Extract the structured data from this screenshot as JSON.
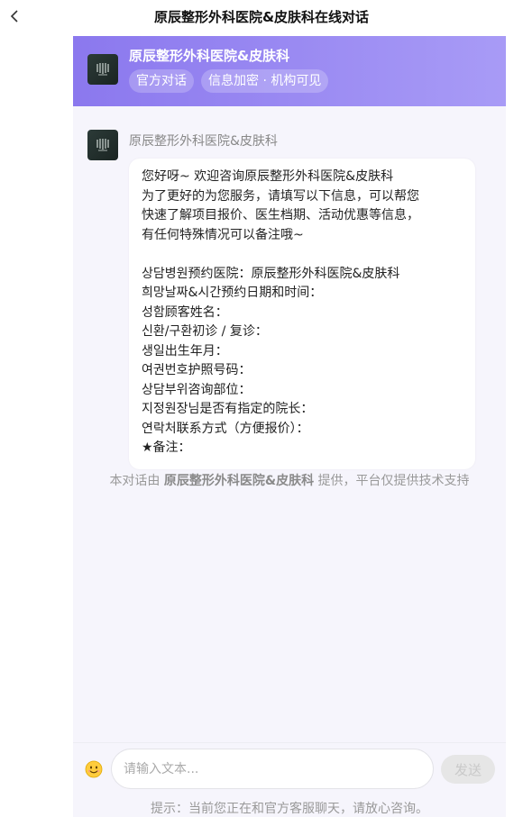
{
  "page": {
    "title": "原辰整形外科医院&皮肤科在线对话",
    "back_icon": "chevron-left-icon"
  },
  "header": {
    "name": "原辰整形外科医院&皮肤科",
    "logo_icon": "clinic-logo-icon",
    "tags": [
      "官方对话",
      "信息加密 · 机构可见"
    ],
    "gradient_start": "#8b78ee",
    "gradient_end": "#a89bf6"
  },
  "message": {
    "sender": "原辰整形外科医院&皮肤科",
    "lines": [
      "您好呀~ 欢迎咨询原辰整形外科医院&皮肤科",
      "为了更好的为您服务，请填写以下信息，可以帮您",
      "快速了解项目报价、医生档期、活动优惠等信息，",
      "有任何特殊情况可以备注哦~",
      "",
      "상담병원预约医院：原辰整形外科医院&皮肤科",
      "희망날짜&시간预约日期和时间：",
      "성함顾客姓名：",
      "신환/구환初诊 / 复诊：",
      "생일出生年月：",
      "여권번호护照号码：",
      "상담부위咨询部位：",
      "지정원장님是否有指定的院长：",
      "연락처联系方式（方便报价）：",
      "★备注："
    ]
  },
  "notice": {
    "prefix": "本对话由 ",
    "org": "原辰整形外科医院&皮肤科",
    "suffix": " 提供，平台仅提供技术支持"
  },
  "composer": {
    "emoji_icon": "smiley-icon",
    "placeholder": "请输入文本...",
    "value": "",
    "send_label": "发送"
  },
  "hint": "提示：当前您正在和官方客服聊天，请放心咨询。"
}
